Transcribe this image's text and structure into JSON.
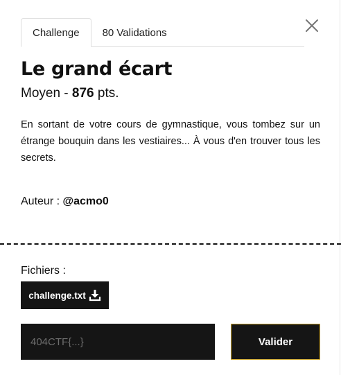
{
  "tabs": [
    {
      "label": "Challenge",
      "active": true
    },
    {
      "label": "80 Validations",
      "active": false
    }
  ],
  "close_icon": "close-icon",
  "challenge": {
    "title": "Le grand écart",
    "difficulty": "Moyen",
    "separator": " - ",
    "points": "876",
    "points_suffix": " pts.",
    "description": "En sortant de votre cours de gymnastique, vous tombez sur un étrange bouquin dans les vestiaires... À vous d'en trouver tous les secrets.",
    "author_label": "Auteur : ",
    "author_name": "@acmo0"
  },
  "files": {
    "label": "Fichiers :",
    "items": [
      {
        "name": "challenge.txt",
        "icon": "download-icon"
      }
    ]
  },
  "flag_form": {
    "placeholder": "404CTF{...}",
    "value": "",
    "submit_label": "Valider"
  },
  "colors": {
    "dark": "#151515",
    "accent_border": "#c9a227",
    "placeholder": "#6d6d6d"
  }
}
